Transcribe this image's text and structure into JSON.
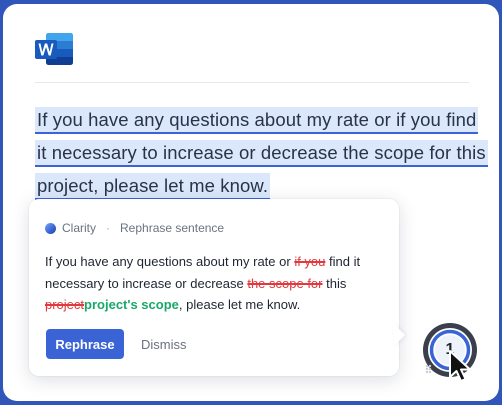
{
  "app": {
    "icon": "word-app-icon",
    "brand_color": "#2b5fc4"
  },
  "document": {
    "lines": [
      "If you have any questions about my rate or if you find",
      "it necessary to increase or decrease the scope for this",
      "project, please let me know."
    ],
    "highlight_color": "#dbe8fb"
  },
  "suggestion": {
    "product": "Clarity",
    "action": "Rephrase sentence",
    "segments": [
      {
        "type": "keep",
        "text": "If you have any questions about my rate or "
      },
      {
        "type": "delete",
        "text": "if you"
      },
      {
        "type": "keep",
        "text": " find it necessary to increase or decrease "
      },
      {
        "type": "delete",
        "text": "the scope for"
      },
      {
        "type": "keep",
        "text": " this "
      },
      {
        "type": "delete",
        "text": "project"
      },
      {
        "type": "insert",
        "text": "project's scope"
      },
      {
        "type": "keep",
        "text": ", please let me know."
      }
    ],
    "primary_button": "Rephrase",
    "secondary_button": "Dismiss",
    "delete_color": "#e0393e",
    "insert_color": "#19a86a"
  },
  "badge": {
    "count": "1",
    "accent": "#3a63d6"
  }
}
